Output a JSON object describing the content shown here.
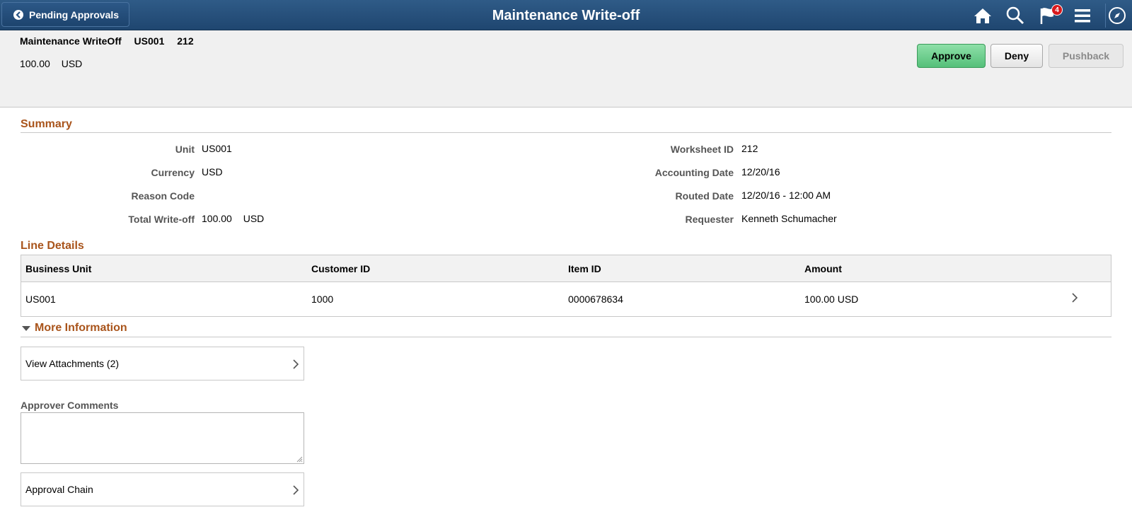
{
  "banner": {
    "back_label": "Pending Approvals",
    "title": "Maintenance Write-off",
    "icons": [
      "home-icon",
      "search-icon",
      "notifications-flag-icon",
      "menu-icon",
      "navbar-compass-icon"
    ],
    "notification_count": "4"
  },
  "header": {
    "doc_type": "Maintenance WriteOff",
    "unit": "US001",
    "worksheet": "212",
    "amount": "100.00",
    "currency": "USD",
    "actions": {
      "approve": "Approve",
      "deny": "Deny",
      "pushback": "Pushback"
    },
    "colors": {
      "approve": "#55c07a",
      "banner": "#1f4670",
      "section": "#a9541b"
    }
  },
  "summary": {
    "heading": "Summary",
    "left": [
      {
        "label": "Unit",
        "value": "US001"
      },
      {
        "label": "Currency",
        "value": "USD"
      },
      {
        "label": "Reason Code",
        "value": ""
      },
      {
        "label": "Total Write-off",
        "value": "100.00",
        "value2": "USD"
      }
    ],
    "right": [
      {
        "label": "Worksheet ID",
        "value": "212"
      },
      {
        "label": "Accounting Date",
        "value": "12/20/16"
      },
      {
        "label": "Routed Date",
        "value": "12/20/16 - 12:00 AM"
      },
      {
        "label": "Requester",
        "value": "Kenneth Schumacher"
      }
    ]
  },
  "line_details": {
    "heading": "Line Details",
    "columns": [
      "Business Unit",
      "Customer ID",
      "Item ID",
      "Amount"
    ],
    "rows": [
      [
        "US001",
        "1000",
        "0000678634",
        "100.00 USD"
      ]
    ]
  },
  "more_info": {
    "heading": "More Information",
    "attachments_label": "View Attachments (2)",
    "comments_label": "Approver Comments",
    "comments_value": "",
    "approval_chain_label": "Approval Chain"
  }
}
